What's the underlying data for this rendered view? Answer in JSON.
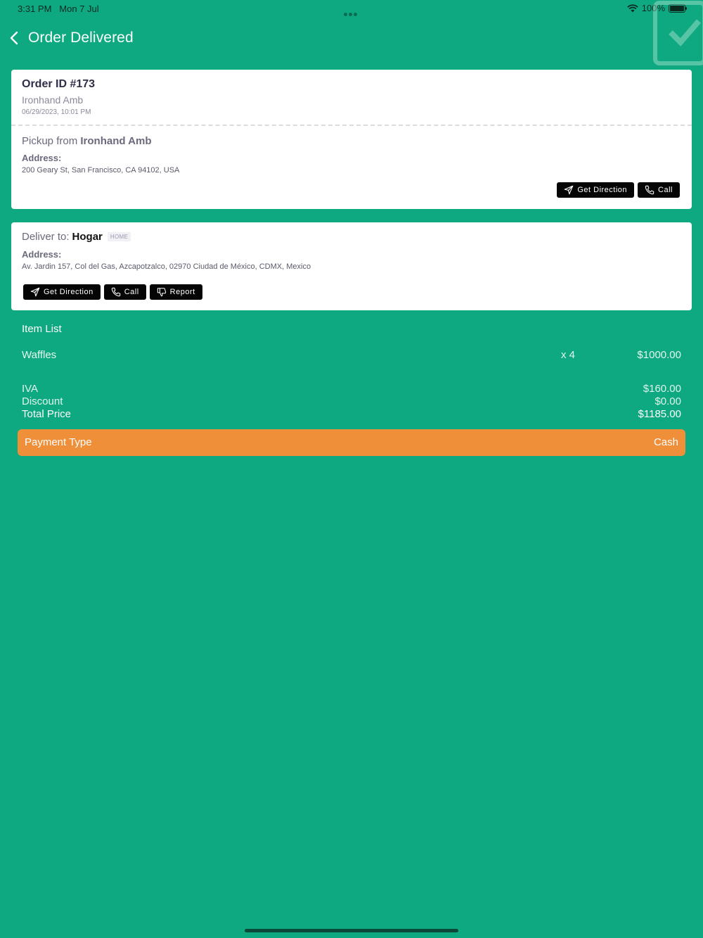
{
  "status_bar": {
    "time": "3:31 PM",
    "date": "Mon 7 Jul",
    "battery": "100%"
  },
  "header": {
    "title": "Order Delivered",
    "back_icon": "chevron-left-icon"
  },
  "pickup_card": {
    "order_id": "Order ID #173",
    "store": "Ironhand Amb",
    "date": "06/29/2023, 10:01 PM",
    "pickup_prefix": "Pickup from",
    "pickup_name": "Ironhand Amb",
    "address_label": "Address:",
    "address": "200 Geary St, San Francisco, CA 94102, USA",
    "buttons": {
      "direction": "Get Direction",
      "call": "Call"
    }
  },
  "deliver_card": {
    "deliver_prefix": "Deliver to:",
    "deliver_name": "Hogar",
    "tag": "HOME",
    "address_label": "Address:",
    "address": "Av. Jardin 157, Col del Gas, Azcapotzalco, 02970 Ciudad de México, CDMX, Mexico",
    "buttons": {
      "direction": "Get Direction",
      "call": "Call",
      "report": "Report"
    }
  },
  "items": {
    "heading": "Item List",
    "list": [
      {
        "name": "Waffles",
        "qty": "x 4",
        "price": "$1000.00"
      }
    ]
  },
  "summary": {
    "iva_label": "IVA",
    "iva_value": "$160.00",
    "discount_label": "Discount",
    "discount_value": "$0.00",
    "total_label": "Total Price",
    "total_value": "$1185.00"
  },
  "payment": {
    "label": "Payment Type",
    "value": "Cash"
  },
  "colors": {
    "background": "#0ea980",
    "accent_orange": "#f08f3a",
    "button_dark": "#050505"
  }
}
